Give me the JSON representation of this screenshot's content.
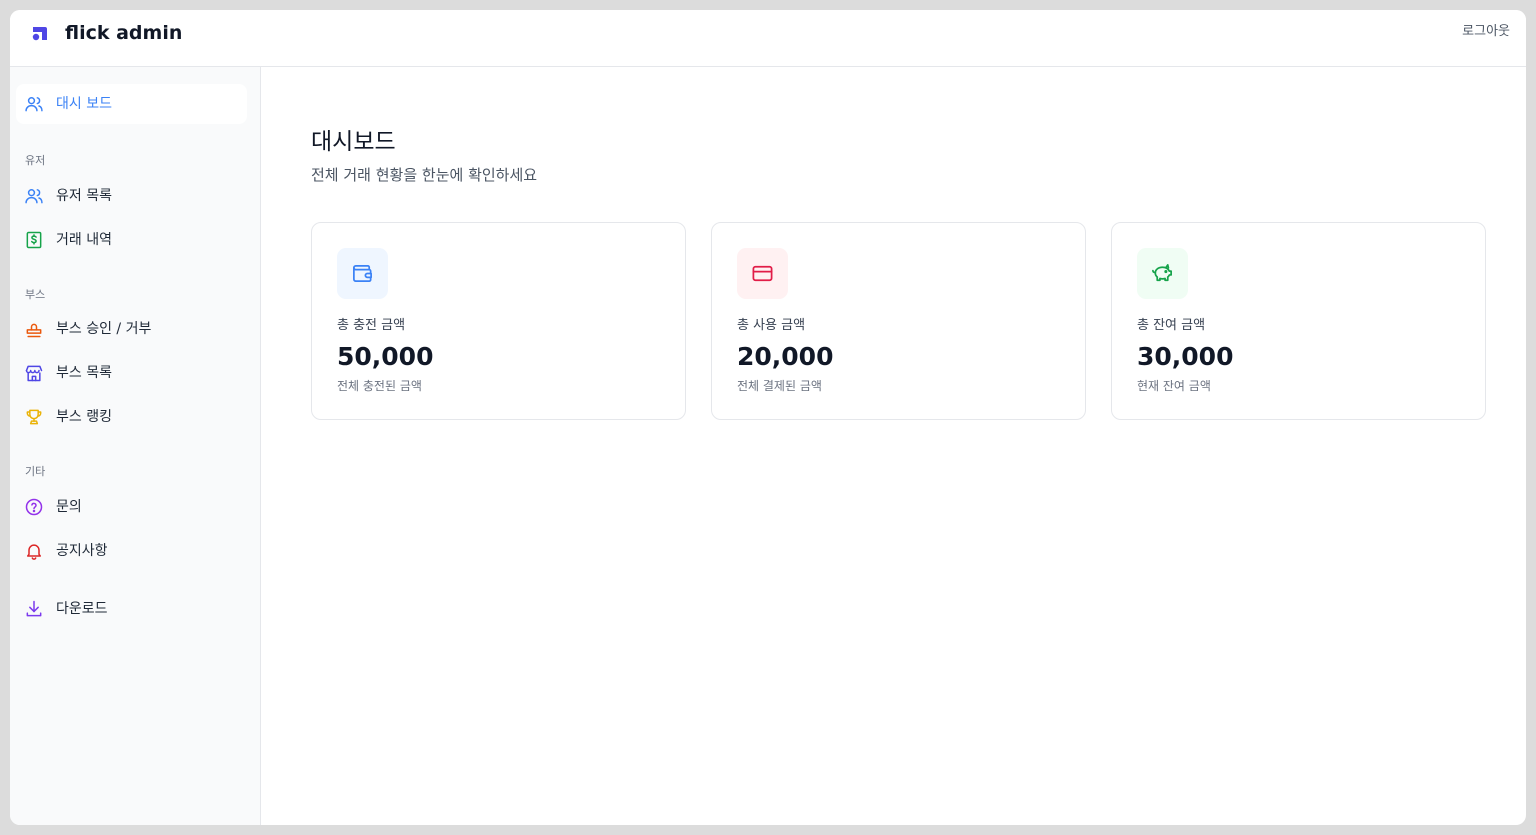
{
  "header": {
    "brand": "flick admin",
    "logout_label": "로그아웃"
  },
  "sidebar": {
    "dashboard_label": "대시 보드",
    "sections": [
      {
        "title": "유저",
        "items": [
          {
            "label": "유저 목록",
            "icon": "users-icon"
          },
          {
            "label": "거래 내역",
            "icon": "dollar-receipt-icon"
          }
        ]
      },
      {
        "title": "부스",
        "items": [
          {
            "label": "부스 승인 / 거부",
            "icon": "stamp-icon"
          },
          {
            "label": "부스 목록",
            "icon": "store-icon"
          },
          {
            "label": "부스 랭킹",
            "icon": "trophy-icon"
          }
        ]
      },
      {
        "title": "기타",
        "items": [
          {
            "label": "문의",
            "icon": "help-circle-icon"
          },
          {
            "label": "공지사항",
            "icon": "bell-icon"
          }
        ]
      }
    ],
    "download_label": "다운로드"
  },
  "main": {
    "title": "대시보드",
    "subtitle": "전체 거래 현황을 한눈에 확인하세요",
    "cards": [
      {
        "label": "총 충전 금액",
        "value": "50,000",
        "desc": "전체 충전된 금액",
        "icon": "wallet-icon",
        "color": "#3b82f6",
        "bg": "#eff6ff"
      },
      {
        "label": "총 사용 금액",
        "value": "20,000",
        "desc": "전체 결제된 금액",
        "icon": "credit-card-icon",
        "color": "#e11d48",
        "bg": "#fff1f2"
      },
      {
        "label": "총 잔여 금액",
        "value": "30,000",
        "desc": "현재 잔여 금액",
        "icon": "piggy-bank-icon",
        "color": "#16a34a",
        "bg": "#f0fdf4"
      }
    ]
  },
  "colors": {
    "accent": "#3b82f6",
    "sidebar_bg": "#f9fafb",
    "border": "#e5e7eb"
  }
}
